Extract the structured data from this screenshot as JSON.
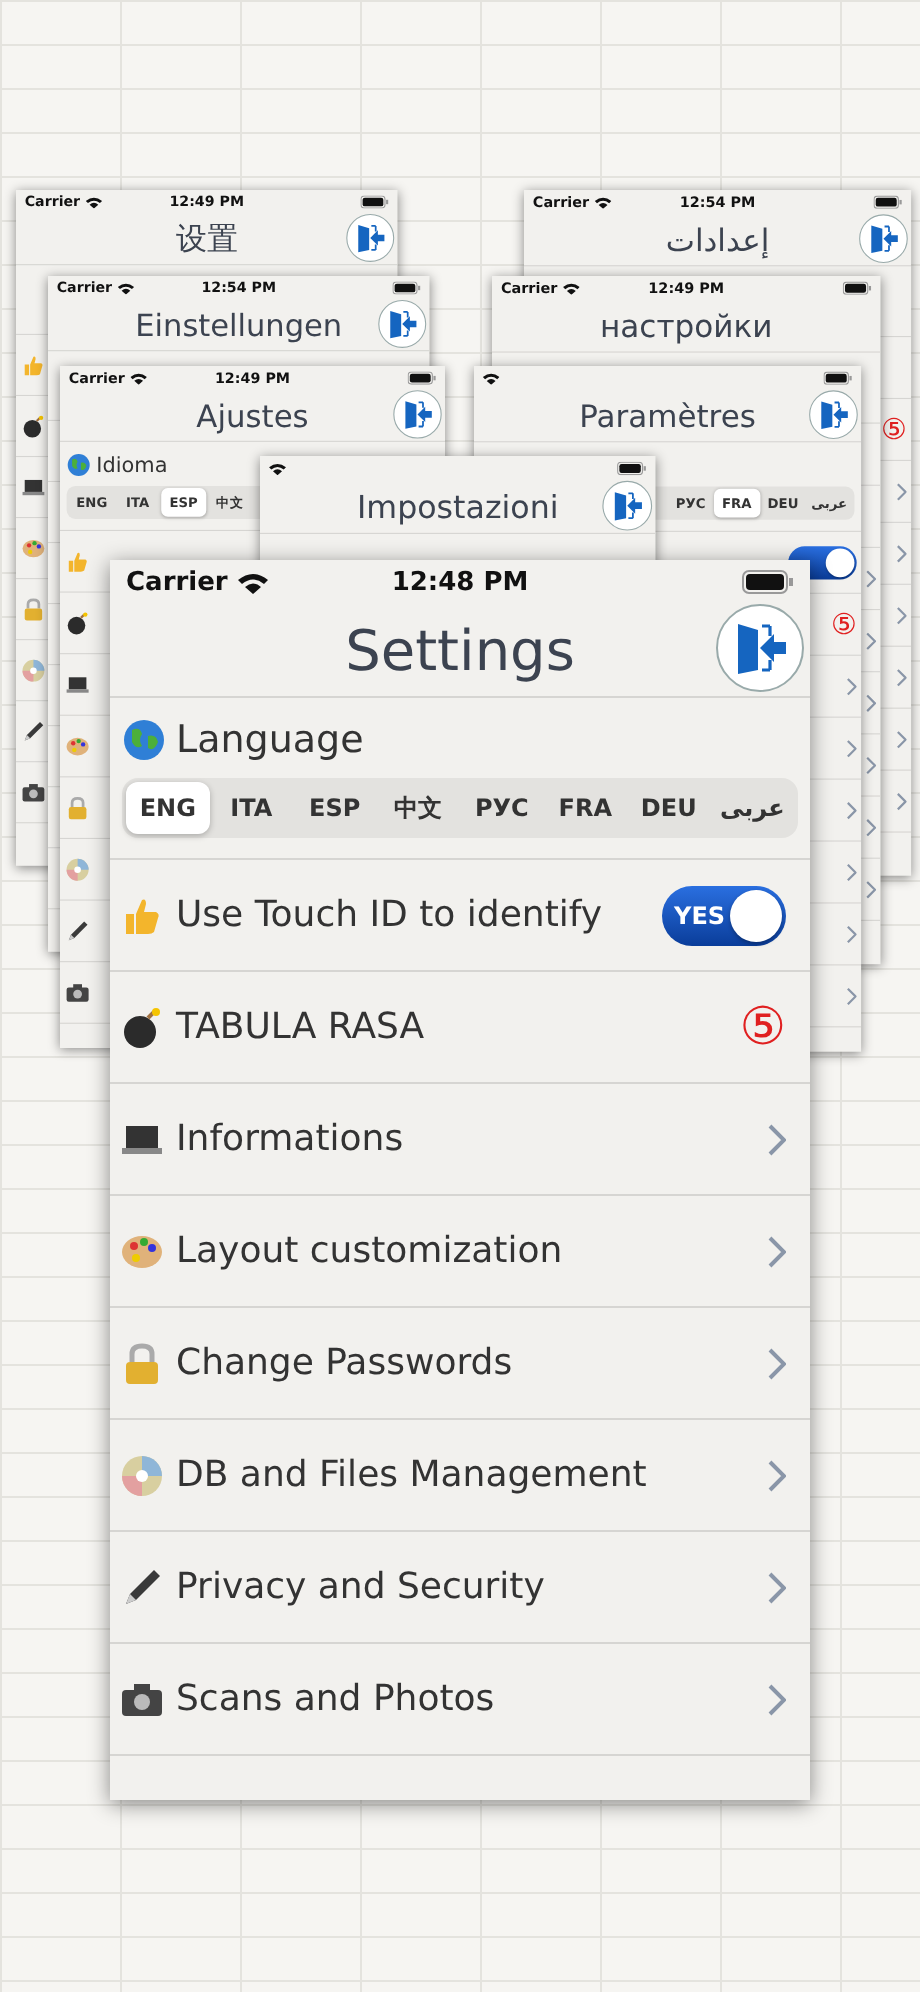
{
  "background_screens": [
    {
      "title": "设置",
      "carrier": "Carrier",
      "time": "12:49 PM"
    },
    {
      "title": "Einstellungen",
      "carrier": "Carrier",
      "time": "12:54 PM"
    },
    {
      "title": "Ajustes",
      "carrier": "Carrier",
      "time": "12:49 PM",
      "language_label": "Idioma",
      "segments": [
        {
          "label": "ENG",
          "selected": false
        },
        {
          "label": "ITA",
          "selected": false
        },
        {
          "label": "ESP",
          "selected": true
        },
        {
          "label": "中文",
          "selected": false
        }
      ]
    },
    {
      "title": "إعدادات",
      "carrier": "Carrier",
      "time": "12:54 PM",
      "badge": "⑤"
    },
    {
      "title": "настройки",
      "carrier": "Carrier",
      "time": "12:49 PM"
    },
    {
      "title": "Paramètres",
      "segments": [
        {
          "label": "РУС",
          "selected": false
        },
        {
          "label": "FRA",
          "selected": true
        },
        {
          "label": "DEU",
          "selected": false
        },
        {
          "label": "عربى",
          "selected": false
        }
      ],
      "toggle": {
        "on": true
      },
      "badge": "⑤"
    },
    {
      "title": "Impostazioni"
    }
  ],
  "main": {
    "carrier": "Carrier",
    "time": "12:48 PM",
    "title": "Settings",
    "language_label": "Language",
    "segments": [
      {
        "label": "ENG",
        "selected": true
      },
      {
        "label": "ITA",
        "selected": false
      },
      {
        "label": "ESP",
        "selected": false
      },
      {
        "label": "中文",
        "selected": false
      },
      {
        "label": "РУС",
        "selected": false
      },
      {
        "label": "FRA",
        "selected": false
      },
      {
        "label": "DEU",
        "selected": false
      },
      {
        "label": "عربى",
        "selected": false
      }
    ],
    "rows": [
      {
        "kind": "toggle",
        "label": "Use Touch ID to identify",
        "toggle_text": "YES",
        "on": true
      },
      {
        "kind": "badge",
        "label": "TABULA RASA",
        "badge": "⑤"
      },
      {
        "kind": "link",
        "label": "Informations"
      },
      {
        "kind": "link",
        "label": "Layout customization"
      },
      {
        "kind": "link",
        "label": "Change Passwords"
      },
      {
        "kind": "link",
        "label": "DB and Files Management"
      },
      {
        "kind": "link",
        "label": "Privacy and Security"
      },
      {
        "kind": "link",
        "label": "Scans and Photos"
      }
    ]
  }
}
